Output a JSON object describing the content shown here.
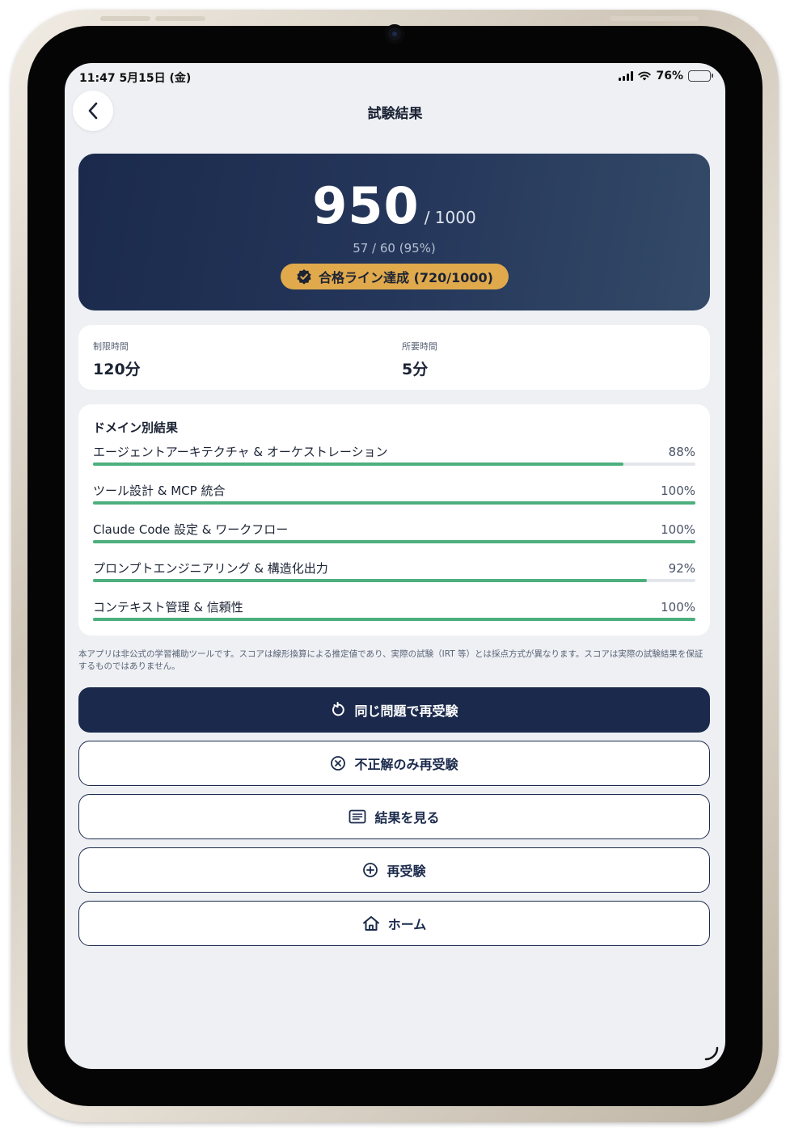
{
  "status_bar": {
    "time_date": "11:47   5月15日 (金)",
    "battery": "76%",
    "battery_level": 0.76
  },
  "header": {
    "title": "試験結果",
    "back_icon": "chevron-left-icon"
  },
  "score": {
    "value": "950",
    "max": "/ 1000",
    "detail": "57 / 60  (95%)",
    "pass_badge": "合格ライン達成 (720/1000)",
    "badge_icon": "verified-check-icon",
    "badge_color": "#e0a94c",
    "card_color": "#1b2a4c"
  },
  "time": {
    "limit_label": "制限時間",
    "limit_value": "120分",
    "used_label": "所要時間",
    "used_value": "5分"
  },
  "domains": {
    "title": "ドメイン別結果",
    "bar_color": "#4caf7d",
    "items": [
      {
        "name": "エージェントアーキテクチャ & オーケストレーション",
        "pct_label": "88%",
        "pct": 88
      },
      {
        "name": "ツール設計 & MCP 統合",
        "pct_label": "100%",
        "pct": 100
      },
      {
        "name": "Claude Code 設定 & ワークフロー",
        "pct_label": "100%",
        "pct": 100
      },
      {
        "name": "プロンプトエンジニアリング & 構造化出力",
        "pct_label": "92%",
        "pct": 92
      },
      {
        "name": "コンテキスト管理 & 信頼性",
        "pct_label": "100%",
        "pct": 100
      }
    ]
  },
  "disclaimer": "本アプリは非公式の学習補助ツールです。スコアは線形換算による推定値であり、実際の試験（IRT 等）とは採点方式が異なります。スコアは実際の試験結果を保証するものではありません。",
  "actions": {
    "retry_same": "同じ問題で再受験",
    "retry_incorrect": "不正解のみ再受験",
    "view_results": "結果を見る",
    "retake": "再受験",
    "home": "ホーム"
  }
}
